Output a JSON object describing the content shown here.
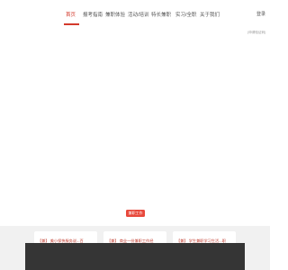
{
  "nav": {
    "tabs": [
      {
        "label": "首页",
        "active": true
      },
      {
        "label": "报考指南"
      },
      {
        "label": "兼职体验"
      },
      {
        "label": "活动/培训"
      },
      {
        "label": "特长兼职"
      },
      {
        "label": "实习/全职"
      },
      {
        "label": "关于我们"
      }
    ],
    "login": "登录",
    "phone_note": "(申请验证码)"
  },
  "section": {
    "tag": "兼职工作"
  },
  "cards": [
    {
      "title": "【兼】 美小保快服务说...百",
      "body": ""
    },
    {
      "title": "【兼】 商业一份兼职工作经",
      "body": ""
    },
    {
      "title": "【兼】 学生兼职学习生活...职",
      "body": ""
    }
  ],
  "colors": {
    "accent": "#d33a2c",
    "tag_bg": "#e8483b",
    "band_bg": "#f1f1f1",
    "overlay": "#282828"
  }
}
